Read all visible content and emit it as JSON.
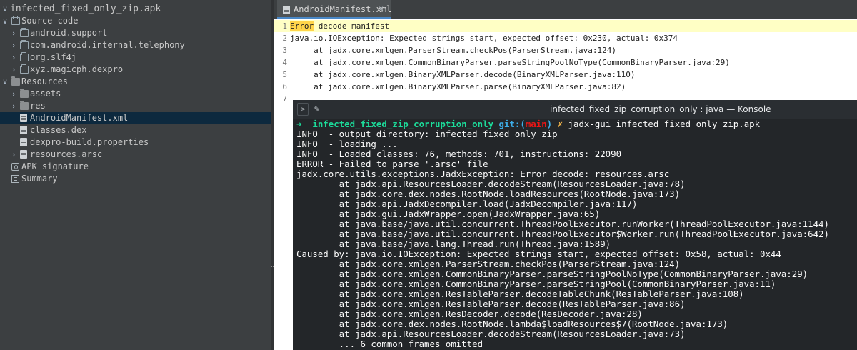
{
  "tree": {
    "root": "infected_fixed_only_zip.apk",
    "items": [
      {
        "label": "Source code",
        "arrow": "∨",
        "icon": "source-folder-icon"
      },
      {
        "label": "android.support",
        "arrow": "›",
        "icon": "package-icon"
      },
      {
        "label": "com.android.internal.telephony",
        "arrow": "›",
        "icon": "package-icon"
      },
      {
        "label": "org.slf4j",
        "arrow": "›",
        "icon": "package-icon"
      },
      {
        "label": "xyz.magicph.dexpro",
        "arrow": "›",
        "icon": "package-icon"
      },
      {
        "label": "Resources",
        "arrow": "∨",
        "icon": "folder-icon"
      },
      {
        "label": "assets",
        "arrow": "›",
        "icon": "folder-icon"
      },
      {
        "label": "res",
        "arrow": "›",
        "icon": "folder-icon"
      },
      {
        "label": "AndroidManifest.xml",
        "arrow": "",
        "icon": "file-icon"
      },
      {
        "label": "classes.dex",
        "arrow": "",
        "icon": "file-icon"
      },
      {
        "label": "dexpro-build.properties",
        "arrow": "",
        "icon": "file-icon"
      },
      {
        "label": "resources.arsc",
        "arrow": "›",
        "icon": "file-icon"
      },
      {
        "label": "APK signature",
        "arrow": "",
        "icon": "signature-icon"
      },
      {
        "label": "Summary",
        "arrow": "",
        "icon": "summary-icon"
      }
    ]
  },
  "editor": {
    "tab_label": "AndroidManifest.xml",
    "tab_close": "×",
    "lines": [
      {
        "num": "1",
        "error_word": "Error",
        "text": " decode manifest"
      },
      {
        "num": "2",
        "text": "java.io.IOException: Expected strings start, expected offset: 0x230, actual: 0x374"
      },
      {
        "num": "3",
        "text": "     at jadx.core.xmlgen.ParserStream.checkPos(ParserStream.java:124)"
      },
      {
        "num": "4",
        "text": "     at jadx.core.xmlgen.CommonBinaryParser.parseStringPoolNoType(CommonBinaryParser.java:29)"
      },
      {
        "num": "5",
        "text": "     at jadx.core.xmlgen.BinaryXMLParser.decode(BinaryXMLParser.java:110)"
      },
      {
        "num": "6",
        "text": "     at jadx.core.xmlgen.BinaryXMLParser.parse(BinaryXMLParser.java:82)"
      },
      {
        "num": "7",
        "text": ""
      }
    ]
  },
  "konsole": {
    "title": "infected_fixed_zip_corruption_only : java — Konsole",
    "expand_button": ">",
    "prompt": {
      "arrow": "➜",
      "dir": "infected_fixed_zip_corruption_only",
      "git": "git:(",
      "branch": "main",
      "git_close": ")",
      "dirty": "✗",
      "command": "jadx-gui infected_fixed_only_zip.apk"
    },
    "lines": [
      "INFO  - output directory: infected_fixed_only_zip",
      "INFO  - loading ...",
      "INFO  - Loaded classes: 76, methods: 701, instructions: 22090",
      "ERROR - Failed to parse '.arsc' file",
      "jadx.core.utils.exceptions.JadxException: Error decode: resources.arsc",
      "        at jadx.api.ResourcesLoader.decodeStream(ResourcesLoader.java:78)",
      "        at jadx.core.dex.nodes.RootNode.loadResources(RootNode.java:173)",
      "        at jadx.api.JadxDecompiler.load(JadxDecompiler.java:117)",
      "        at jadx.gui.JadxWrapper.open(JadxWrapper.java:65)",
      "        at java.base/java.util.concurrent.ThreadPoolExecutor.runWorker(ThreadPoolExecutor.java:1144)",
      "        at java.base/java.util.concurrent.ThreadPoolExecutor$Worker.run(ThreadPoolExecutor.java:642)",
      "        at java.base/java.lang.Thread.run(Thread.java:1589)",
      "Caused by: java.io.IOException: Expected strings start, expected offset: 0x58, actual: 0x44",
      "        at jadx.core.xmlgen.ParserStream.checkPos(ParserStream.java:124)",
      "        at jadx.core.xmlgen.CommonBinaryParser.parseStringPoolNoType(CommonBinaryParser.java:29)",
      "        at jadx.core.xmlgen.CommonBinaryParser.parseStringPool(CommonBinaryParser.java:11)",
      "        at jadx.core.xmlgen.ResTableParser.decodeTableChunk(ResTableParser.java:108)",
      "        at jadx.core.xmlgen.ResTableParser.decode(ResTableParser.java:86)",
      "        at jadx.core.xmlgen.ResDecoder.decode(ResDecoder.java:28)",
      "        at jadx.core.dex.nodes.RootNode.lambda$loadResources$7(RootNode.java:173)",
      "        at jadx.api.ResourcesLoader.decodeStream(ResourcesLoader.java:73)",
      "        ... 6 common frames omitted"
    ]
  }
}
